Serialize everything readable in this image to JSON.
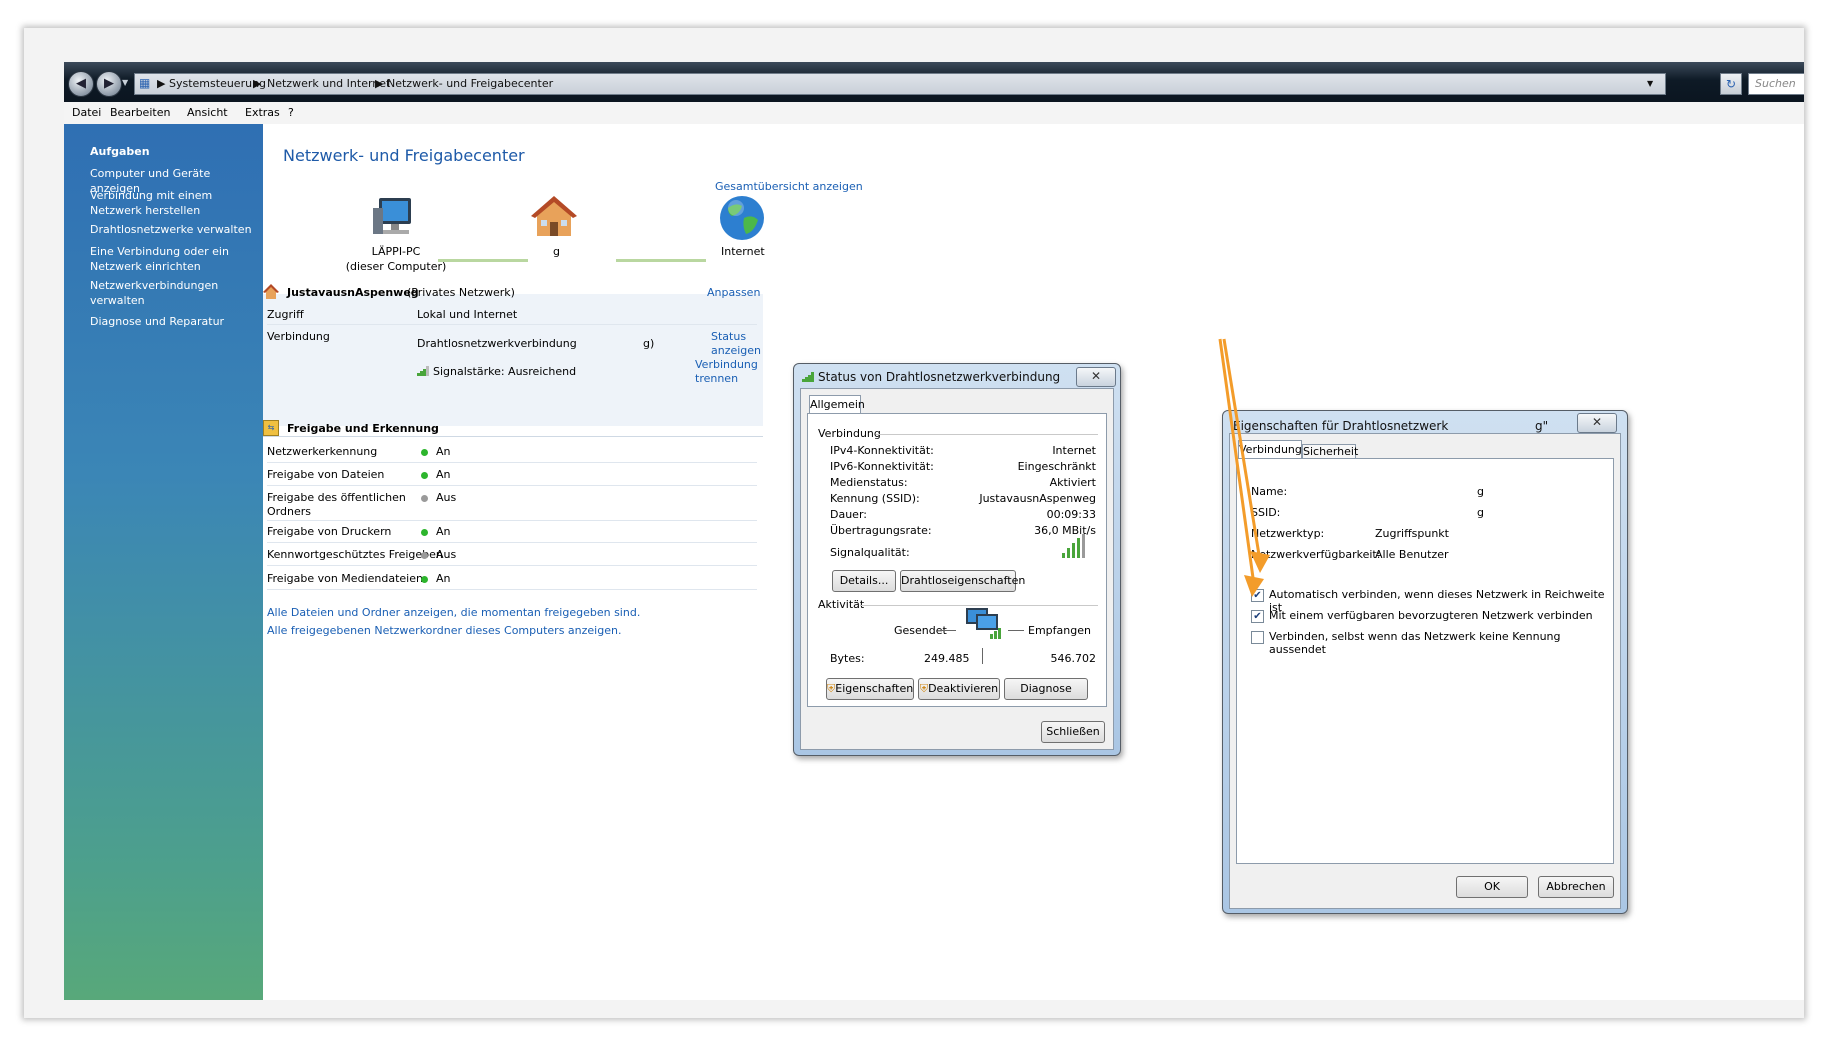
{
  "colors": {
    "accent": "#1a5fb4",
    "sidebar_top": "#2f6fb3",
    "sidebar_bottom": "#58a87a",
    "status_on": "#2db52d",
    "status_off": "#9a9a9a",
    "arrow": "#f39c2a"
  },
  "addressbar": {
    "icon": "control-panel-icon",
    "crumbs": [
      "Systemsteuerung",
      "Netzwerk und Internet",
      "Netzwerk- und Freigabecenter"
    ],
    "search_placeholder": "Suchen"
  },
  "menu": [
    "Datei",
    "Bearbeiten",
    "Ansicht",
    "Extras",
    "?"
  ],
  "sidebar": {
    "heading": "Aufgaben",
    "items": [
      "Computer und Geräte anzeigen",
      "Verbindung mit einem Netzwerk herstellen",
      "Drahtlosnetzwerke verwalten",
      "Eine Verbindung oder ein Netzwerk einrichten",
      "Netzwerkverbindungen verwalten",
      "Diagnose und Reparatur"
    ]
  },
  "main": {
    "title": "Netzwerk- und Freigabecenter",
    "overview_link": "Gesamtübersicht anzeigen",
    "map": {
      "computer_name": "LÄPPI-PC",
      "computer_sub": "(dieser Computer)",
      "network_label": "g",
      "internet_label": "Internet"
    },
    "network": {
      "name": "JustavausnAspenweg",
      "type": "(Privates Netzwerk)",
      "customize": "Anpassen",
      "access_label": "Zugriff",
      "access_value": "Lokal und Internet",
      "connection_label": "Verbindung",
      "connection_value": "Drahtlosnetzwerkverbindung",
      "connection_suffix": "g)",
      "status_link": "Status anzeigen",
      "signal": "Signalstärke: Ausreichend",
      "disconnect_link": "Verbindung trennen"
    },
    "sharing": {
      "title": "Freigabe und Erkennung",
      "rows": [
        {
          "label": "Netzwerkerkennung",
          "value": "An",
          "on": true
        },
        {
          "label": "Freigabe von Dateien",
          "value": "An",
          "on": true
        },
        {
          "label": "Freigabe des öffentlichen Ordners",
          "value": "Aus",
          "on": false
        },
        {
          "label": "Freigabe von Druckern",
          "value": "An",
          "on": true
        },
        {
          "label": "Kennwortgeschütztes Freigeben",
          "value": "Aus",
          "on": false
        },
        {
          "label": "Freigabe von Mediendateien",
          "value": "An",
          "on": true
        }
      ]
    },
    "links": [
      "Alle Dateien und Ordner anzeigen, die momentan freigegeben sind.",
      "Alle freigegebenen Netzwerkordner dieses Computers anzeigen."
    ]
  },
  "status_dialog": {
    "title": "Status von Drahtlosnetzwerkverbindung",
    "tab": "Allgemein",
    "connection_group": "Verbindung",
    "fields": [
      {
        "label": "IPv4-Konnektivität:",
        "value": "Internet"
      },
      {
        "label": "IPv6-Konnektivität:",
        "value": "Eingeschränkt"
      },
      {
        "label": "Medienstatus:",
        "value": "Aktiviert"
      },
      {
        "label": "Kennung (SSID):",
        "value": "JustavausnAspenweg"
      },
      {
        "label": "Dauer:",
        "value": "00:09:33"
      },
      {
        "label": "Übertragungsrate:",
        "value": "36,0 MBit/s"
      }
    ],
    "signal_label": "Signalqualität:",
    "signal_level": 4,
    "signal_max": 5,
    "details_btn": "Details...",
    "wireless_props_btn": "Drahtloseigenschaften",
    "activity_group": "Aktivität",
    "sent_label": "Gesendet",
    "received_label": "Empfangen",
    "bytes_label": "Bytes:",
    "bytes_sent": "249.485",
    "bytes_received": "546.702",
    "properties_btn": "Eigenschaften",
    "deactivate_btn": "Deaktivieren",
    "diagnose_btn": "Diagnose",
    "close_btn": "Schließen"
  },
  "props_dialog": {
    "title": "Eigenschaften für Drahtlosnetzwerk",
    "title_suffix": "g\"",
    "tabs": [
      "Verbindung",
      "Sicherheit"
    ],
    "fields": [
      {
        "label": "Name:",
        "value": "g"
      },
      {
        "label": "SSID:",
        "value": "g"
      },
      {
        "label": "Netzwerktyp:",
        "value": "Zugriffspunkt"
      },
      {
        "label": "Netzwerkverfügbarkeit:",
        "value": "Alle Benutzer"
      }
    ],
    "checkboxes": [
      {
        "label": "Automatisch verbinden, wenn dieses Netzwerk in Reichweite ist",
        "checked": true
      },
      {
        "label": "Mit einem verfügbaren bevorzugteren Netzwerk verbinden",
        "checked": true
      },
      {
        "label": "Verbinden, selbst wenn das Netzwerk keine Kennung aussendet",
        "checked": false
      }
    ],
    "ok_btn": "OK",
    "cancel_btn": "Abbrechen"
  }
}
